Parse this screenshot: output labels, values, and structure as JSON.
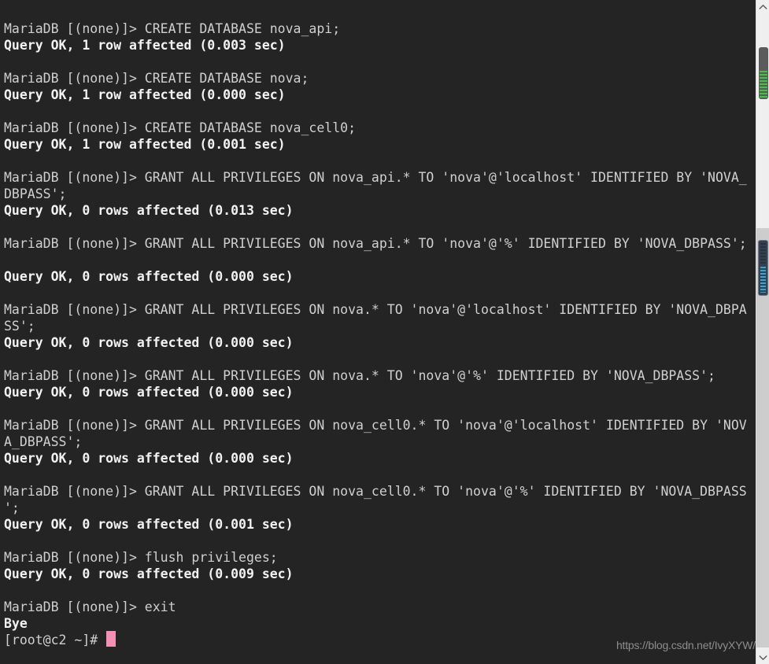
{
  "terminal": {
    "background_color": "#242424",
    "prompt_text_color": "#d0d0d0",
    "result_text_color": "#f2f2f2",
    "cursor_color": "#f48fb6",
    "lines": [
      {
        "kind": "prompt",
        "text": "MariaDB [(none)]> CREATE DATABASE nova_api;"
      },
      {
        "kind": "result",
        "text": "Query OK, 1 row affected (0.003 sec)"
      },
      {
        "kind": "blank",
        "text": ""
      },
      {
        "kind": "prompt",
        "text": "MariaDB [(none)]> CREATE DATABASE nova;"
      },
      {
        "kind": "result",
        "text": "Query OK, 1 row affected (0.000 sec)"
      },
      {
        "kind": "blank",
        "text": ""
      },
      {
        "kind": "prompt",
        "text": "MariaDB [(none)]> CREATE DATABASE nova_cell0;"
      },
      {
        "kind": "result",
        "text": "Query OK, 1 row affected (0.001 sec)"
      },
      {
        "kind": "blank",
        "text": ""
      },
      {
        "kind": "prompt",
        "text": "MariaDB [(none)]> GRANT ALL PRIVILEGES ON nova_api.* TO 'nova'@'localhost' IDENTIFIED BY 'NOVA_"
      },
      {
        "kind": "prompt",
        "text": "DBPASS';"
      },
      {
        "kind": "result",
        "text": "Query OK, 0 rows affected (0.013 sec)"
      },
      {
        "kind": "blank",
        "text": ""
      },
      {
        "kind": "prompt",
        "text": "MariaDB [(none)]> GRANT ALL PRIVILEGES ON nova_api.* TO 'nova'@'%' IDENTIFIED BY 'NOVA_DBPASS';"
      },
      {
        "kind": "blank",
        "text": ""
      },
      {
        "kind": "result",
        "text": "Query OK, 0 rows affected (0.000 sec)"
      },
      {
        "kind": "blank",
        "text": ""
      },
      {
        "kind": "prompt",
        "text": "MariaDB [(none)]> GRANT ALL PRIVILEGES ON nova.* TO 'nova'@'localhost' IDENTIFIED BY 'NOVA_DBPA"
      },
      {
        "kind": "prompt",
        "text": "SS';"
      },
      {
        "kind": "result",
        "text": "Query OK, 0 rows affected (0.000 sec)"
      },
      {
        "kind": "blank",
        "text": ""
      },
      {
        "kind": "prompt",
        "text": "MariaDB [(none)]> GRANT ALL PRIVILEGES ON nova.* TO 'nova'@'%' IDENTIFIED BY 'NOVA_DBPASS';"
      },
      {
        "kind": "result",
        "text": "Query OK, 0 rows affected (0.000 sec)"
      },
      {
        "kind": "blank",
        "text": ""
      },
      {
        "kind": "prompt",
        "text": "MariaDB [(none)]> GRANT ALL PRIVILEGES ON nova_cell0.* TO 'nova'@'localhost' IDENTIFIED BY 'NOV"
      },
      {
        "kind": "prompt",
        "text": "A_DBPASS';"
      },
      {
        "kind": "result",
        "text": "Query OK, 0 rows affected (0.000 sec)"
      },
      {
        "kind": "blank",
        "text": ""
      },
      {
        "kind": "prompt",
        "text": "MariaDB [(none)]> GRANT ALL PRIVILEGES ON nova_cell0.* TO 'nova'@'%' IDENTIFIED BY 'NOVA_DBPASS"
      },
      {
        "kind": "prompt",
        "text": "';"
      },
      {
        "kind": "result",
        "text": "Query OK, 0 rows affected (0.001 sec)"
      },
      {
        "kind": "blank",
        "text": ""
      },
      {
        "kind": "prompt",
        "text": "MariaDB [(none)]> flush privileges;"
      },
      {
        "kind": "result",
        "text": "Query OK, 0 rows affected (0.009 sec)"
      },
      {
        "kind": "blank",
        "text": ""
      },
      {
        "kind": "prompt",
        "text": "MariaDB [(none)]> exit"
      },
      {
        "kind": "result",
        "text": "Bye"
      },
      {
        "kind": "shell",
        "text": "[root@c2 ~]# "
      }
    ]
  },
  "watermark": {
    "text": "https://blog.csdn.net/IvyXYW/",
    "color": "#8d8d8d"
  },
  "scrollbar": {
    "track_color": "#efefef",
    "track_lower_color": "#cdcdcd",
    "arrow_up": "chevron-up-icon",
    "arrow_down": "chevron-down-icon",
    "thumb_primary": {
      "name": "scrollbar-thumb-green",
      "body_color": "#5b5b5b",
      "stripe_color": "#3ec73e"
    },
    "thumb_secondary": {
      "name": "scrollbar-thumb-blue",
      "body_color": "#36414f",
      "stripe_color": "#2ea8d8"
    }
  }
}
